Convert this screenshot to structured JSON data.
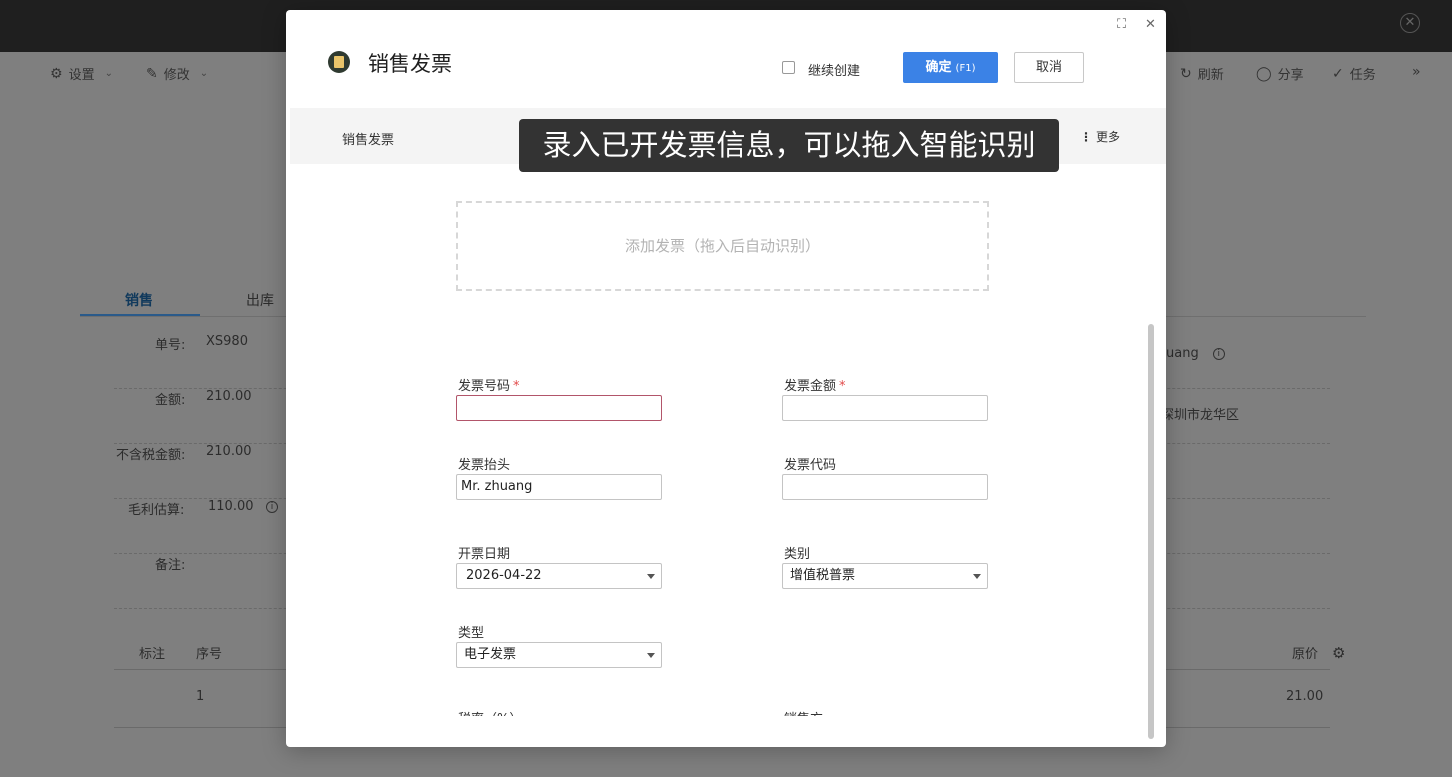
{
  "bg": {
    "toolbar_left": [
      {
        "icon": "gear-icon",
        "label": "设置"
      },
      {
        "icon": "edit-icon",
        "label": "修改"
      }
    ],
    "toolbar_right": [
      {
        "icon": "refresh-icon",
        "label": "刷新"
      },
      {
        "icon": "share-icon",
        "label": "分享"
      },
      {
        "icon": "task-icon",
        "label": "任务"
      }
    ],
    "tabs": [
      "销售",
      "出库"
    ],
    "fields": [
      {
        "label": "单号:",
        "value": "XS980"
      },
      {
        "label": "金额:",
        "value": "210.00"
      },
      {
        "label": "不含税金额:",
        "value": "210.00"
      },
      {
        "label": "毛利估算:",
        "value": "110.00"
      },
      {
        "label": "备注:",
        "value": ""
      }
    ],
    "right_values": [
      "uang",
      "深圳市龙华区"
    ],
    "table_headers": {
      "mark": "标注",
      "seq": "序号",
      "price": "原价"
    },
    "table_row": {
      "seq": "1",
      "price": "21.00"
    }
  },
  "modal": {
    "title": "销售发票",
    "continue_create": "继续创建",
    "ok_label": "确定",
    "ok_hint": "(F1)",
    "cancel_label": "取消",
    "subbar_title": "销售发票",
    "more_label": "更多",
    "tooltip": "录入已开发票信息，可以拖入智能识别",
    "drop_zone": "添加发票（拖入后自动识别）",
    "fields": {
      "invoice_no": {
        "label": "发票号码",
        "value": ""
      },
      "invoice_amount": {
        "label": "发票金额",
        "value": ""
      },
      "invoice_title": {
        "label": "发票抬头",
        "value": "Mr. zhuang"
      },
      "invoice_code": {
        "label": "发票代码",
        "value": ""
      },
      "invoice_date": {
        "label": "开票日期",
        "value": "2026-04-22"
      },
      "category": {
        "label": "类别",
        "value": "增值税普票"
      },
      "type": {
        "label": "类型",
        "value": "电子发票"
      }
    },
    "cut_labels": [
      "税率（%）",
      "销售方"
    ],
    "required_mark": "*"
  }
}
